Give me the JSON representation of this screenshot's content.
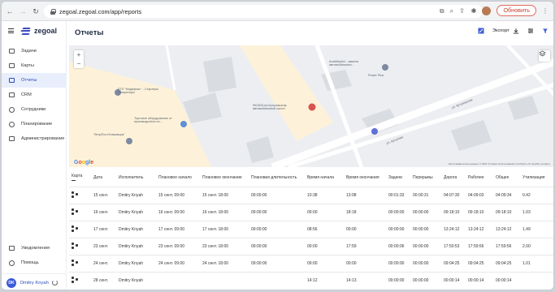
{
  "browser": {
    "url": "zegoal.zegoal.com/app/reports",
    "update_label": "Обновить"
  },
  "sidebar": {
    "logo": "zegoal",
    "items": [
      {
        "label": "Задачи",
        "icon": "tasks-icon",
        "active": false
      },
      {
        "label": "Карты",
        "icon": "map-icon",
        "active": false
      },
      {
        "label": "Отчеты",
        "icon": "reports-icon",
        "active": true
      },
      {
        "label": "CRM",
        "icon": "crm-icon",
        "active": false
      },
      {
        "label": "Сотрудники",
        "icon": "employees-icon",
        "active": false
      },
      {
        "label": "Планирование",
        "icon": "planning-icon",
        "active": false
      },
      {
        "label": "Администрирование",
        "icon": "admin-icon",
        "active": false
      }
    ],
    "notifications": "Уведомления",
    "help": "Помощь",
    "user": {
      "initials": "DK",
      "name": "Dmitry Knyah"
    }
  },
  "header": {
    "title": "Отчеты",
    "export_label": "Экспорт"
  },
  "map": {
    "labels": [
      "ЕТЛ \"Модификс\" - Стартеры Генераторы",
      "Торговое оборудование от производителя по...",
      "\"ВторПостУпаковщик\"",
      "SKODA на Кутузовском, автомобильный салон",
      "AutoMaxArt - замена автомобильных...",
      "Power Plus",
      "ул. Кутузова",
      "ул. Кутузовская"
    ],
    "google": "Google",
    "attribution": "Картографические данные © 2021  Условия использования  Сообщить об ошибке на карте"
  },
  "table": {
    "columns": [
      "Карта",
      "Дата",
      "Исполнитель",
      "Плановое начало",
      "Плановое окончание",
      "Плановая длительность",
      "Время начала",
      "Время окончания",
      "Задачи",
      "Перерывы",
      "Дорога",
      "Рабочее",
      "Общее",
      "Утилизация"
    ],
    "rows": [
      [
        "15 сент.",
        "Dmitry Knyah",
        "15 сент. 09:00",
        "15 сент. 18:00",
        "09:00:00",
        "10:38",
        "13:08",
        "00:01:33",
        "00:00:31",
        "04:07:30",
        "04:09:03",
        "04:09:34",
        "0.42"
      ],
      [
        "16 сент.",
        "Dmitry Knyah",
        "16 сент. 09:00",
        "16 сент. 18:00",
        "09:00:00",
        "09:00",
        "18:18",
        "00:00:00",
        "00:00:00",
        "09:18:10",
        "09:18:10",
        "09:18:10",
        "1.03"
      ],
      [
        "17 сент.",
        "Dmitry Knyah",
        "17 сент. 09:00",
        "17 сент. 18:00",
        "09:00:00",
        "08:56",
        "00:00",
        "00:00:00",
        "00:00:00",
        "13:24:12",
        "13:24:12",
        "13:24:12",
        "1.49"
      ],
      [
        "23 сент.",
        "Dmitry Knyah",
        "23 сент. 09:00",
        "23 сент. 18:00",
        "09:00:00",
        "00:00",
        "17:59",
        "00:00:06",
        "00:00:00",
        "17:50:53",
        "17:59:56",
        "17:59:56",
        "2.00"
      ],
      [
        "24 сент.",
        "Dmitry Knyah",
        "24 сент. 09:00",
        "24 сент. 18:00",
        "09:00:00",
        "09:00",
        "00:00",
        "00:00:00",
        "00:00:00",
        "09:04:25",
        "09:04:25",
        "09:04:25",
        "1.01"
      ],
      [
        "28 сент.",
        "Dmitry Knyah",
        "",
        "",
        "",
        "14:12",
        "14:13",
        "00:00:00",
        "00:00:00",
        "00:00:14",
        "00:00:14",
        "00:00:14",
        ""
      ]
    ]
  },
  "colors": {
    "accent": "#2b4ab8",
    "active_bg": "#e8eefc",
    "update_red": "#c5412f",
    "map_zone": "#fdf2d9"
  }
}
